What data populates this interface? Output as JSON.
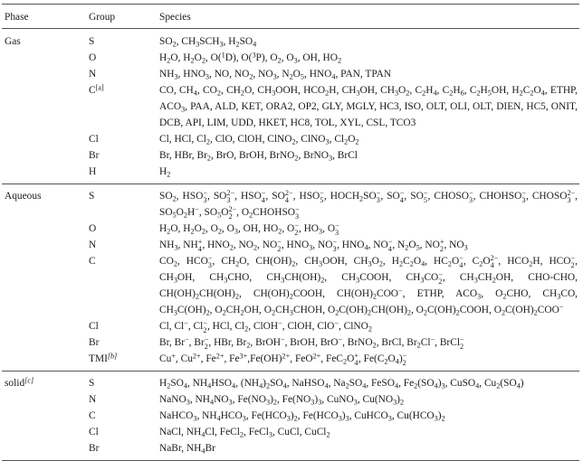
{
  "header": {
    "phase": "Phase",
    "group": "Group",
    "species": "Species"
  },
  "sections": [
    {
      "phase": "Gas",
      "phase_note": "",
      "groups": [
        {
          "group": "S",
          "note": "",
          "species": "SO_2, CH_3SCH_3, H_2SO_4"
        },
        {
          "group": "O",
          "note": "",
          "species": "H_2O, H_2O_2, O(^1D), O(^3P), O_2, O_3, OH, HO_2"
        },
        {
          "group": "N",
          "note": "",
          "species": "NH_3, HNO_3, NO, NO_2, NO_3, N_2O_5, HNO_4, PAN, TPAN"
        },
        {
          "group": "C",
          "note": "[a]",
          "species": "CO, CH_4, CO_2, CH_2O, CH_3OOH, HCO_2H, CH_3OH, CH_3O_2, C_2H_4, C_2H_6, C_2H_5OH, H_2C_2O_4, ETHP, ACO_3, PAA, ALD, KET, ORA2, OP2, GLY, MGLY, HC3, ISO, OLT, OLI, OLT, DIEN, HC5, ONIT, DCB, API, LIM, UDD, HKET, HC8, TOL, XYL, CSL, TCO3"
        },
        {
          "group": "Cl",
          "note": "",
          "species": "Cl, HCl, Cl_2, ClO, ClOH, ClNO_2, ClNO_3, Cl_2O_2"
        },
        {
          "group": "Br",
          "note": "",
          "species": "Br, HBr, Br_2, BrO, BrOH, BrNO_2, BrNO_3, BrCl"
        },
        {
          "group": "H",
          "note": "",
          "species": "H_2"
        }
      ]
    },
    {
      "phase": "Aqueous",
      "phase_note": "",
      "groups": [
        {
          "group": "S",
          "note": "",
          "species": "SO_2, HSO_3{-}, SO_3{2-}, HSO_4{-}, SO_4{2-}, HSO_5{-}, HOCH_2SO_3{-}, SO_4{-}, SO_5{-}, CHOSO_3{-}, CHOHSO_3{-}, CHOSO_3{2-}, SO_5O_2H^−, SO_5O_2{2-}, O_2CHOHSO_3{-}"
        },
        {
          "group": "O",
          "note": "",
          "species": "H_2O, H_2O_2, O_2, O_3, OH, HO_2, O_2{-}, HO_3, O_3{-}"
        },
        {
          "group": "N",
          "note": "",
          "species": "NH_3, NH_4{+}, HNO_2, NO_2, NO_2{-}, HNO_3, NO_3{-}, HNO_4, NO_4{-}, N_2O_5, NO_2{+}, NO_3"
        },
        {
          "group": "C",
          "note": "",
          "species": "CO_2, HCO_3{-}, CH_2O, CH(OH)_2, CH_3OOH, CH_3O_2, H_2C_2O_4, HC_2O_4{-}, C_2O_4{2-}, HCO_2H, HCO_2{-}, CH_3OH, CH_3CHO, CH_3CH(OH)_2, CH_3COOH, CH_3CO_2{-}, CH_3CH_2OH, CHO-CHO, CH(OH)_2CH(OH)_2, CH(OH)_2COOH, CH(OH)_2COO^−, ETHP, ACO_3, O_2CHO, CH_3CO, CH_3C(OH)_2, O_2CH_2OH, O_2CH_3CHOH, O_2C(OH)_2CH(OH)_2, O_2C(OH)_2COOH, O_2C(OH)_2COO^−"
        },
        {
          "group": "Cl",
          "note": "",
          "species": "Cl, Cl^−, Cl_2{-}, HCl, Cl_2, ClOH^−, ClOH, ClO^−, ClNO_2"
        },
        {
          "group": "Br",
          "note": "",
          "species": "Br, Br^−, Br_2{-}, HBr, Br_2, BrOH^−, BrOH, BrO^−, BrNO_2, BrCl, Br_2Cl^−, BrCl_2{-}"
        },
        {
          "group": "TMI",
          "note": "[b]",
          "species": "Cu^+, Cu^2+, Fe^2+, Fe^3+,Fe(OH)^2+, FeO^2+, FeC_2O_4{+}, Fe(C_2O_4)_2{-}"
        }
      ]
    },
    {
      "phase": "solid",
      "phase_note": "[c]",
      "groups": [
        {
          "group": "S",
          "note": "",
          "species": "H_2SO_4, NH_4HSO_4, (NH_4)_2SO_4, NaHSO_4, Na_2SO_4, FeSO_4, Fe_2(SO_4)_3, CuSO_4, Cu_2(SO_4)"
        },
        {
          "group": "N",
          "note": "",
          "species": "NaNO_3, NH_4NO_3, Fe(NO_3)_2, Fe(NO_3)_3, CuNO_3, Cu(NO_3)_2"
        },
        {
          "group": "C",
          "note": "",
          "species": "NaHCO_3, NH_4HCO_3, Fe(HCO_3)_2, Fe(HCO_3)_3, CuHCO_3, Cu(HCO_3)_2"
        },
        {
          "group": "Cl",
          "note": "",
          "species": "NaCl, NH_4Cl, FeCl_2, FeCl_3, CuCl, CuCl_2"
        },
        {
          "group": "Br",
          "note": "",
          "species": "NaBr, NH_4Br"
        }
      ]
    }
  ]
}
